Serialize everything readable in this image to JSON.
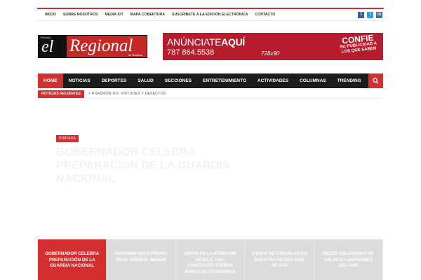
{
  "topnav": {
    "items": [
      "INICIO",
      "SOBRE NOSOTROS",
      "MEDIA KIT",
      "MAPA COBERTURA",
      "SUSCRIBETE A LA EDICIÓN ELECTRÓNICA",
      "CONTACTO"
    ]
  },
  "social": {
    "facebook": "f",
    "twitter": "t",
    "instagram": "in"
  },
  "logo": {
    "prefix": "Periódico",
    "mark": "el",
    "name": "Regional",
    "sub": "de Guayama"
  },
  "ad": {
    "line1_a": "ANÚNCIATE",
    "line1_b": "AQUÍ",
    "phone": "787 864.5538",
    "size": "728x90",
    "right_big": "CONFIE",
    "right_small_1": "SU PUBLICIDAD A",
    "right_small_2": "LOS QUE SABEN"
  },
  "mainnav": {
    "items": [
      "HOME",
      "NOTICIAS",
      "DEPORTES",
      "SALUD",
      "SECCIONES",
      "ENTRETENIMIENTO",
      "ACTIVIDADES",
      "COLUMNAS",
      "TRENDING"
    ],
    "search_icon": "search-icon"
  },
  "ticker": {
    "label": "NOTICIAS RECIENTES",
    "text": "× POKÉMON GO: VIRTUDES Y DEFECTOS"
  },
  "hero": {
    "tag": "PORTADA",
    "title": "GOBERNADOR CELEBRA PREPARACIÓN DE LA GUARDIA NACIONAL"
  },
  "strip": {
    "cards": [
      "GOBERNADOR CELEBRA PREPARACIÓN DE LA GUARDIA NACIONAL",
      "GUAYAMA DIO CATEDRA EN EL BÉISBOL MENOR",
      "CRISIS EN LA ATENCIÓN MÉDICA, UNA CONSTANTE ETERNA PARA LOS VETERANOS",
      "CIERRE DE ESCUELAS EN NUESTRA REGIÓN DOS SE VAN",
      "PECES VOLADORES DE SALINAS CAMPEONES DEL SUR"
    ]
  }
}
